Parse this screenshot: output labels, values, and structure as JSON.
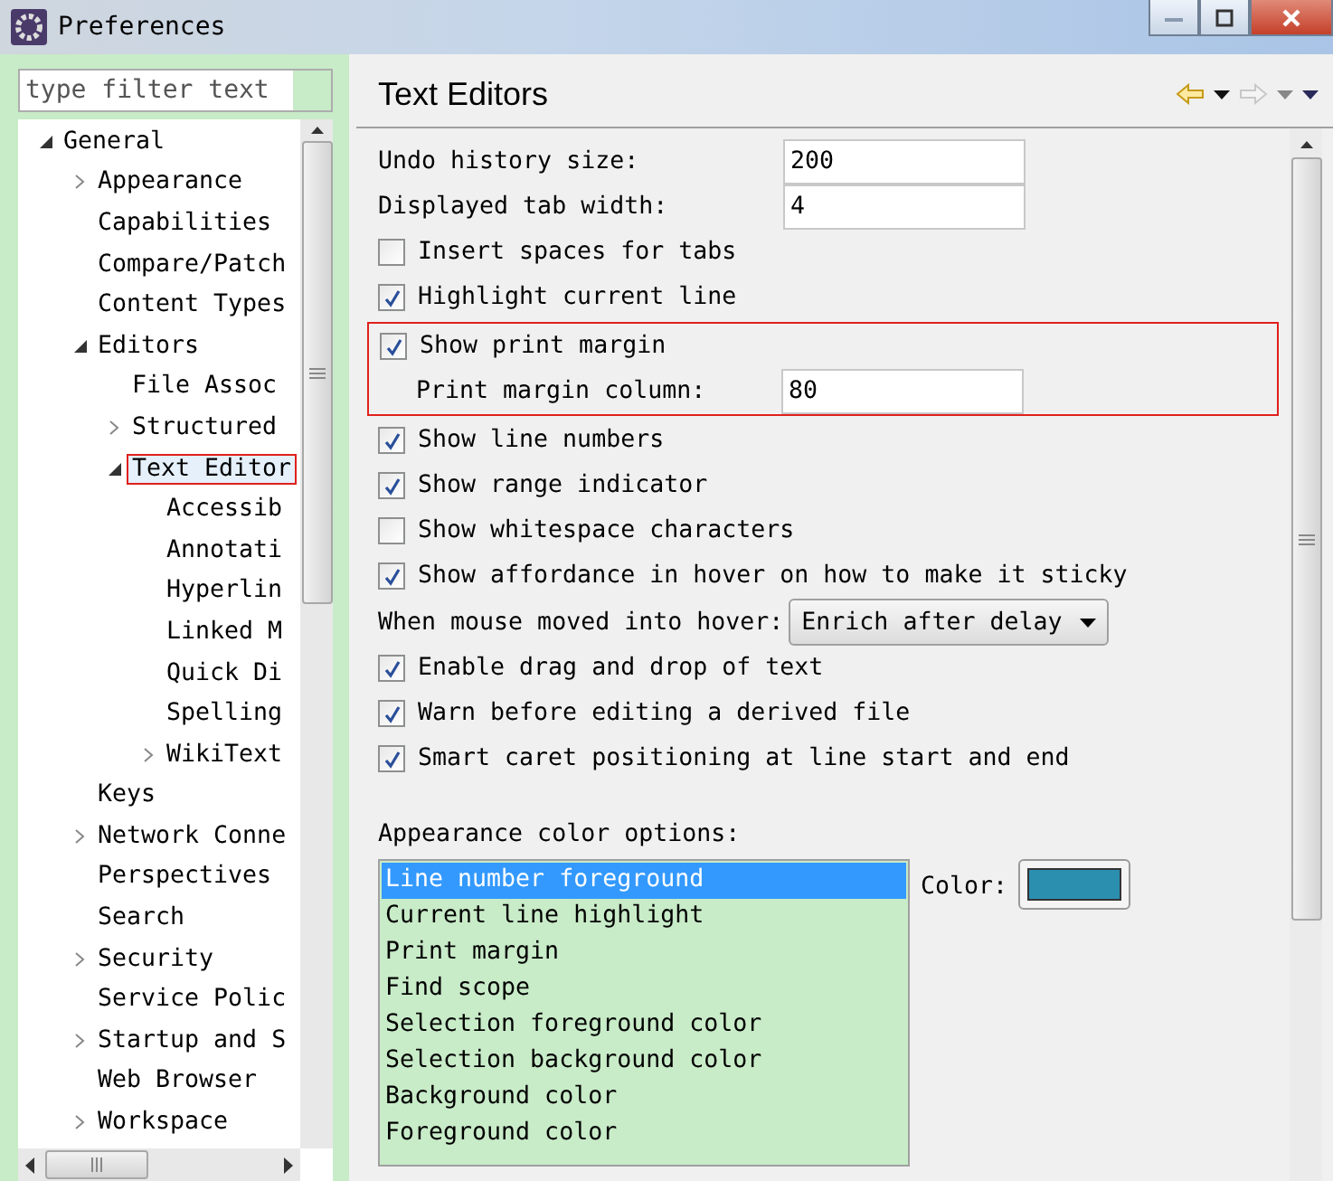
{
  "window": {
    "title": "Preferences"
  },
  "filter": {
    "placeholder": "type filter text"
  },
  "tree": [
    {
      "label": "General",
      "expanded": true,
      "children": [
        {
          "label": "Appearance",
          "expanded": false
        },
        {
          "label": "Capabilities"
        },
        {
          "label": "Compare/Patch"
        },
        {
          "label": "Content Types"
        },
        {
          "label": "Editors",
          "expanded": true,
          "children": [
            {
              "label": "File Assoc"
            },
            {
              "label": "Structured",
              "expanded": false
            },
            {
              "label": "Text Editor",
              "expanded": true,
              "annotated": true,
              "children": [
                {
                  "label": "Accessib"
                },
                {
                  "label": "Annotati"
                },
                {
                  "label": "Hyperlin"
                },
                {
                  "label": "Linked M"
                },
                {
                  "label": "Quick Di"
                },
                {
                  "label": "Spelling"
                },
                {
                  "label": "WikiText",
                  "expanded": false
                }
              ]
            }
          ]
        },
        {
          "label": "Keys"
        },
        {
          "label": "Network Conne",
          "expanded": false
        },
        {
          "label": "Perspectives"
        },
        {
          "label": "Search"
        },
        {
          "label": "Security",
          "expanded": false
        },
        {
          "label": "Service Polic"
        },
        {
          "label": "Startup and S",
          "expanded": false
        },
        {
          "label": "Web Browser"
        },
        {
          "label": "Workspace",
          "expanded": false
        }
      ]
    }
  ],
  "page": {
    "title": "Text Editors"
  },
  "options": [
    {
      "kind": "field",
      "label": "Undo history size:",
      "value": "200"
    },
    {
      "kind": "field",
      "label": "Displayed tab width:",
      "value": "4"
    },
    {
      "kind": "checkbox",
      "label": "Insert spaces for tabs",
      "checked": false
    },
    {
      "kind": "checkbox",
      "label": "Highlight current line",
      "checked": true
    },
    {
      "kind": "group",
      "annotated": true,
      "items": [
        {
          "kind": "checkbox",
          "label": "Show print margin",
          "checked": true
        },
        {
          "kind": "field",
          "label": "Print margin column:",
          "value": "80"
        }
      ]
    },
    {
      "kind": "checkbox",
      "label": "Show line numbers",
      "checked": true
    },
    {
      "kind": "checkbox",
      "label": "Show range indicator",
      "checked": true
    },
    {
      "kind": "checkbox",
      "label": "Show whitespace characters",
      "checked": false
    },
    {
      "kind": "checkbox",
      "label": "Show affordance in hover on how to make it sticky",
      "checked": true
    },
    {
      "kind": "dropdown",
      "label": "When mouse moved into hover:",
      "value": "Enrich after delay"
    },
    {
      "kind": "checkbox",
      "label": "Enable drag and drop of text",
      "checked": true
    },
    {
      "kind": "checkbox",
      "label": "Warn before editing a derived file",
      "checked": true
    },
    {
      "kind": "checkbox",
      "label": "Smart caret positioning at line start and end",
      "checked": true
    }
  ],
  "appearance": {
    "label": "Appearance color options:",
    "items": [
      {
        "label": "Line number foreground",
        "selected": true
      },
      {
        "label": "Current line highlight",
        "selected": false
      },
      {
        "label": "Print margin",
        "selected": false
      },
      {
        "label": "Find scope",
        "selected": false
      },
      {
        "label": "Selection foreground color",
        "selected": false
      },
      {
        "label": "Selection background color",
        "selected": false
      },
      {
        "label": "Background color",
        "selected": false
      },
      {
        "label": "Foreground color",
        "selected": false
      }
    ],
    "color_label": "Color:",
    "color": "#2b8fb0"
  }
}
